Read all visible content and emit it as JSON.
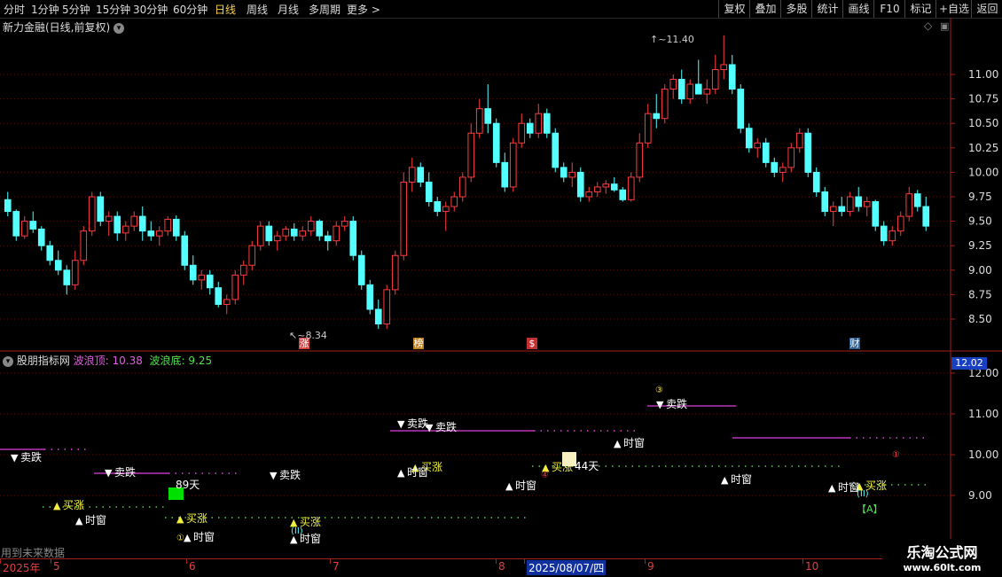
{
  "toolbar": {
    "timeframes": [
      "分时",
      "1分钟",
      "5分钟",
      "15分钟",
      "30分钟",
      "60分钟",
      "日线",
      "周线",
      "月线",
      "多周期",
      "更多 >"
    ],
    "active": "日线",
    "right_buttons": [
      "复权",
      "叠加",
      "多股",
      "统计",
      "画线",
      "F10",
      "标记",
      "+自选",
      "返回"
    ]
  },
  "main_chart": {
    "title": "新力金融(日线,前复权)",
    "high_label": "11.40",
    "low_label": "8.34",
    "y_ticks": [
      "11.00",
      "10.75",
      "10.50",
      "10.25",
      "10.00",
      "9.75",
      "9.50",
      "9.25",
      "9.00",
      "8.75",
      "8.50"
    ],
    "ylim": [
      8.3,
      11.45
    ],
    "event_markers": [
      {
        "label": "涨",
        "color": "#d84040",
        "text_color": "#ffffff"
      },
      {
        "label": "榜",
        "color": "#c08020",
        "text_color": "#ffffff"
      },
      {
        "label": "$",
        "color": "#c03030",
        "text_color": "#ffffff"
      },
      {
        "label": "财",
        "color": "#2f5f8f",
        "text_color": "#ffffff"
      }
    ],
    "up_color": "#ff3c3c",
    "down_color": "#54ffff"
  },
  "indicator": {
    "name": "股朋指标网",
    "wave_top_label": "波浪顶:",
    "wave_top_value": "10.38",
    "wave_bottom_label": "波浪底:",
    "wave_bottom_value": "9.25",
    "current_value": "12.02",
    "y_ticks": [
      "12.00",
      "11.00",
      "10.00",
      "9.00"
    ],
    "signals": {
      "sell": "卖跌",
      "buy": "买涨",
      "window": "时窗"
    },
    "day_labels": [
      "89天",
      "44天"
    ],
    "circled_numbers": [
      "③",
      "④",
      "①",
      "①",
      "(II)",
      "(II)"
    ],
    "letter_a": "【A】",
    "footer_note": "用到未来数据"
  },
  "date_axis": {
    "labels": [
      "2025年",
      "5",
      "6",
      "7",
      "8",
      "2025/08/07/四",
      "9",
      "10"
    ]
  },
  "watermark": {
    "title": "乐淘公式网",
    "url": "www.60lt.com"
  },
  "chart_data": {
    "type": "candlestick",
    "title": "新力金融(日线,前复权)",
    "ylim": [
      8.3,
      11.45
    ],
    "x": [
      "2025-04",
      "2025-05",
      "2025-06",
      "2025-07",
      "2025-08",
      "2025-09",
      "2025-10"
    ],
    "ohlc": [
      [
        9.72,
        9.8,
        9.55,
        9.6
      ],
      [
        9.6,
        9.62,
        9.3,
        9.35
      ],
      [
        9.35,
        9.55,
        9.32,
        9.5
      ],
      [
        9.5,
        9.6,
        9.38,
        9.42
      ],
      [
        9.42,
        9.45,
        9.2,
        9.25
      ],
      [
        9.25,
        9.3,
        9.05,
        9.1
      ],
      [
        9.1,
        9.2,
        8.95,
        9.0
      ],
      [
        9.0,
        9.05,
        8.75,
        8.85
      ],
      [
        8.85,
        9.2,
        8.8,
        9.1
      ],
      [
        9.1,
        9.45,
        9.05,
        9.4
      ],
      [
        9.4,
        9.8,
        9.35,
        9.75
      ],
      [
        9.75,
        9.8,
        9.45,
        9.5
      ],
      [
        9.5,
        9.6,
        9.35,
        9.55
      ],
      [
        9.55,
        9.6,
        9.3,
        9.38
      ],
      [
        9.38,
        9.5,
        9.3,
        9.45
      ],
      [
        9.45,
        9.6,
        9.4,
        9.55
      ],
      [
        9.55,
        9.65,
        9.3,
        9.4
      ],
      [
        9.4,
        9.5,
        9.3,
        9.35
      ],
      [
        9.35,
        9.45,
        9.25,
        9.4
      ],
      [
        9.4,
        9.55,
        9.35,
        9.52
      ],
      [
        9.52,
        9.56,
        9.3,
        9.35
      ],
      [
        9.35,
        9.4,
        9.0,
        9.05
      ],
      [
        9.05,
        9.15,
        8.85,
        8.9
      ],
      [
        8.9,
        9.0,
        8.8,
        8.95
      ],
      [
        8.95,
        9.0,
        8.75,
        8.82
      ],
      [
        8.82,
        8.88,
        8.62,
        8.65
      ],
      [
        8.65,
        8.75,
        8.55,
        8.7
      ],
      [
        8.7,
        9.0,
        8.65,
        8.95
      ],
      [
        8.95,
        9.1,
        8.85,
        9.05
      ],
      [
        9.05,
        9.3,
        9.0,
        9.25
      ],
      [
        9.25,
        9.5,
        9.2,
        9.45
      ],
      [
        9.45,
        9.5,
        9.25,
        9.3
      ],
      [
        9.3,
        9.4,
        9.2,
        9.35
      ],
      [
        9.35,
        9.45,
        9.3,
        9.42
      ],
      [
        9.42,
        9.48,
        9.3,
        9.35
      ],
      [
        9.35,
        9.45,
        9.3,
        9.4
      ],
      [
        9.4,
        9.55,
        9.35,
        9.5
      ],
      [
        9.5,
        9.52,
        9.3,
        9.35
      ],
      [
        9.35,
        9.4,
        9.2,
        9.3
      ],
      [
        9.3,
        9.5,
        9.25,
        9.45
      ],
      [
        9.45,
        9.55,
        9.4,
        9.5
      ],
      [
        9.5,
        9.55,
        9.1,
        9.15
      ],
      [
        9.15,
        9.2,
        8.8,
        8.85
      ],
      [
        8.85,
        8.9,
        8.55,
        8.6
      ],
      [
        8.6,
        8.7,
        8.4,
        8.45
      ],
      [
        8.45,
        8.85,
        8.4,
        8.8
      ],
      [
        8.8,
        9.2,
        8.75,
        9.15
      ],
      [
        9.15,
        10.0,
        9.1,
        9.9
      ],
      [
        9.9,
        10.15,
        9.8,
        10.05
      ],
      [
        10.05,
        10.1,
        9.85,
        9.9
      ],
      [
        9.9,
        10.0,
        9.65,
        9.7
      ],
      [
        9.7,
        9.75,
        9.55,
        9.6
      ],
      [
        9.6,
        9.7,
        9.4,
        9.65
      ],
      [
        9.65,
        9.8,
        9.6,
        9.75
      ],
      [
        9.75,
        10.0,
        9.7,
        9.95
      ],
      [
        9.95,
        10.5,
        9.9,
        10.4
      ],
      [
        10.4,
        10.75,
        10.35,
        10.65
      ],
      [
        10.65,
        10.9,
        10.4,
        10.5
      ],
      [
        10.5,
        10.55,
        10.05,
        10.1
      ],
      [
        10.1,
        10.2,
        9.8,
        9.85
      ],
      [
        9.85,
        10.35,
        9.8,
        10.3
      ],
      [
        10.3,
        10.6,
        10.25,
        10.5
      ],
      [
        10.5,
        10.55,
        10.35,
        10.4
      ],
      [
        10.4,
        10.7,
        10.35,
        10.6
      ],
      [
        10.6,
        10.65,
        10.35,
        10.4
      ],
      [
        10.4,
        10.45,
        10.0,
        10.05
      ],
      [
        10.05,
        10.1,
        9.9,
        9.95
      ],
      [
        9.95,
        10.1,
        9.85,
        10.0
      ],
      [
        10.0,
        10.05,
        9.7,
        9.75
      ],
      [
        9.75,
        9.85,
        9.7,
        9.8
      ],
      [
        9.8,
        9.9,
        9.75,
        9.85
      ],
      [
        9.85,
        9.92,
        9.78,
        9.88
      ],
      [
        9.88,
        9.95,
        9.8,
        9.82
      ],
      [
        9.82,
        9.85,
        9.7,
        9.72
      ],
      [
        9.72,
        10.0,
        9.7,
        9.95
      ],
      [
        9.95,
        10.4,
        9.9,
        10.3
      ],
      [
        10.3,
        10.7,
        10.25,
        10.6
      ],
      [
        10.6,
        10.8,
        10.45,
        10.55
      ],
      [
        10.55,
        10.9,
        10.5,
        10.85
      ],
      [
        10.85,
        11.0,
        10.75,
        10.95
      ],
      [
        10.95,
        11.05,
        10.7,
        10.75
      ],
      [
        10.75,
        10.95,
        10.7,
        10.9
      ],
      [
        10.9,
        11.15,
        10.85,
        10.8
      ],
      [
        10.8,
        10.95,
        10.7,
        10.85
      ],
      [
        10.85,
        11.2,
        10.8,
        11.05
      ],
      [
        11.05,
        11.4,
        10.95,
        11.1
      ],
      [
        11.1,
        11.2,
        10.8,
        10.85
      ],
      [
        10.85,
        10.9,
        10.4,
        10.45
      ],
      [
        10.45,
        10.5,
        10.2,
        10.25
      ],
      [
        10.25,
        10.35,
        10.15,
        10.3
      ],
      [
        10.3,
        10.35,
        10.05,
        10.1
      ],
      [
        10.1,
        10.15,
        9.95,
        10.0
      ],
      [
        10.0,
        10.1,
        9.9,
        10.05
      ],
      [
        10.05,
        10.3,
        10.0,
        10.25
      ],
      [
        10.25,
        10.45,
        10.2,
        10.4
      ],
      [
        10.4,
        10.45,
        9.95,
        10.0
      ],
      [
        10.0,
        10.05,
        9.75,
        9.8
      ],
      [
        9.8,
        9.85,
        9.55,
        9.6
      ],
      [
        9.6,
        9.7,
        9.45,
        9.65
      ],
      [
        9.65,
        9.75,
        9.55,
        9.6
      ],
      [
        9.6,
        9.8,
        9.55,
        9.75
      ],
      [
        9.75,
        9.85,
        9.6,
        9.65
      ],
      [
        9.65,
        9.75,
        9.55,
        9.7
      ],
      [
        9.7,
        9.72,
        9.4,
        9.45
      ],
      [
        9.45,
        9.5,
        9.25,
        9.3
      ],
      [
        9.3,
        9.45,
        9.25,
        9.4
      ],
      [
        9.4,
        9.6,
        9.35,
        9.55
      ],
      [
        9.55,
        9.85,
        9.5,
        9.78
      ],
      [
        9.78,
        9.82,
        9.6,
        9.65
      ],
      [
        9.65,
        9.75,
        9.4,
        9.45
      ]
    ]
  }
}
